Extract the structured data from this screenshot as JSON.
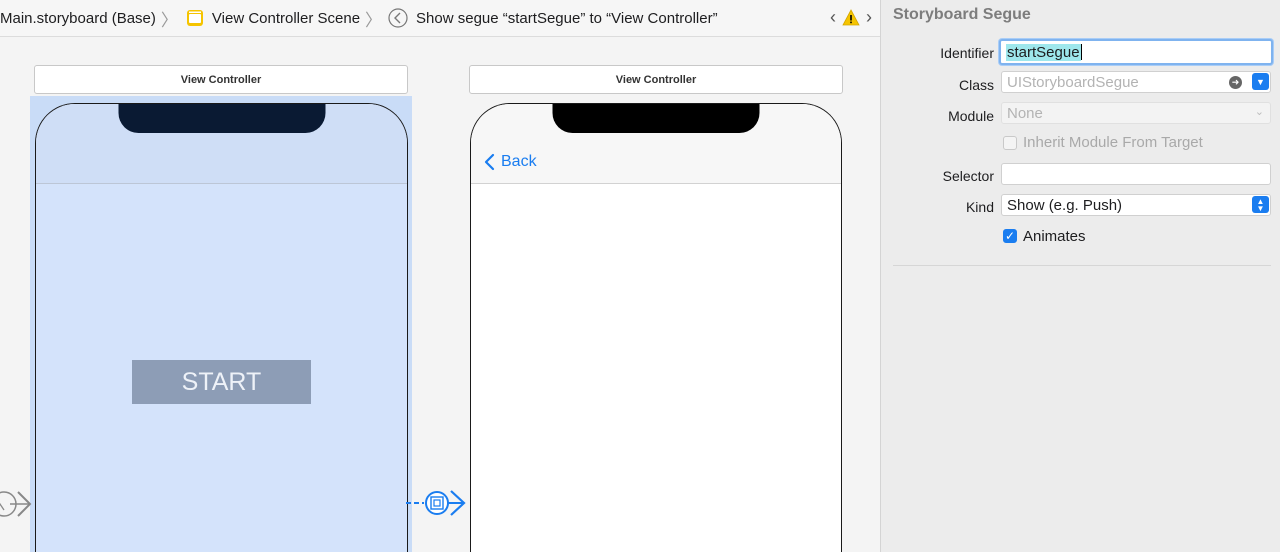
{
  "breadcrumb": {
    "storyboard": "Main.storyboard (Base)",
    "scene": "View Controller Scene",
    "segue": "Show segue “startSegue” to “View Controller”"
  },
  "canvas": {
    "scene1_title": "View Controller",
    "scene2_title": "View Controller",
    "start_button_label": "START",
    "back_label": "Back"
  },
  "inspector": {
    "title": "Storyboard Segue",
    "identifier_label": "Identifier",
    "identifier_value": "startSegue",
    "class_label": "Class",
    "class_placeholder": "UIStoryboardSegue",
    "module_label": "Module",
    "module_placeholder": "None",
    "inherit_label": "Inherit Module From Target",
    "selector_label": "Selector",
    "selector_value": "",
    "kind_label": "Kind",
    "kind_value": "Show (e.g. Push)",
    "animates_label": "Animates",
    "animates_checked": true,
    "inherit_checked": false
  },
  "colors": {
    "accent": "#1a7df0",
    "selection": "#c9dcf7",
    "start_button_bg": "#8d9db6",
    "warning": "#f5c400"
  },
  "icons": [
    "scene-icon",
    "segue-back-icon",
    "chevron-left-icon",
    "warning-icon",
    "chevron-right-icon",
    "entry-point-icon",
    "segue-icon",
    "arrow-circle-icon",
    "chevron-down-icon",
    "updown-icon",
    "checkmark-icon"
  ]
}
